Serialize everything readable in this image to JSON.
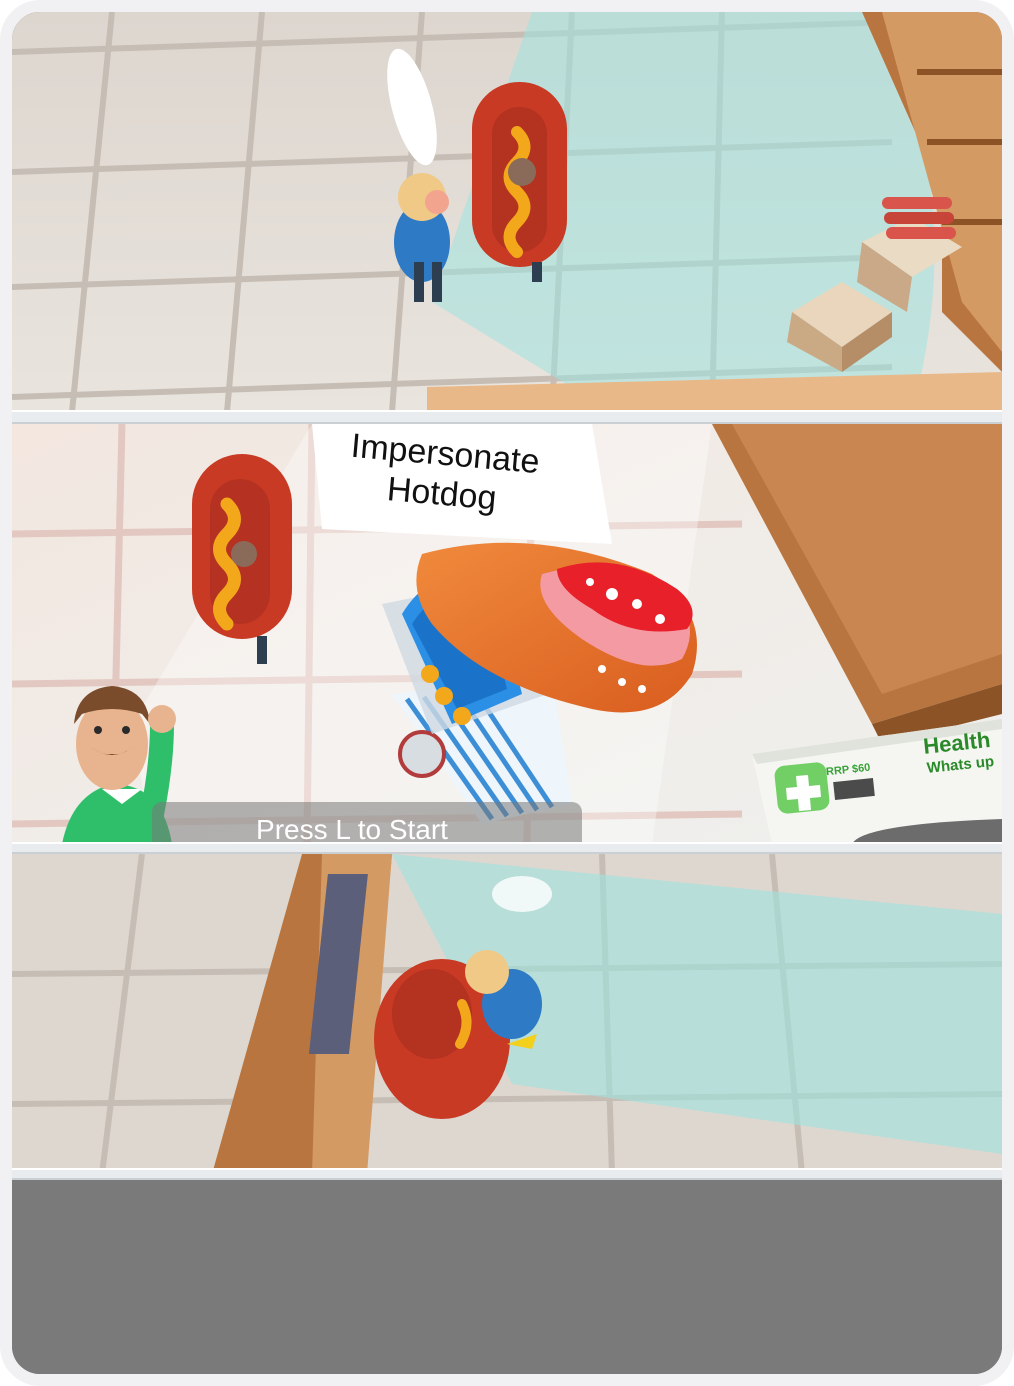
{
  "scene": {
    "panels": [
      "top-view",
      "cutscene",
      "bottom-view"
    ]
  },
  "speech_bubble": {
    "line1": "Impersonate",
    "line2": "Hotdog"
  },
  "prompt": {
    "text": "Press L to Start"
  },
  "product_box": {
    "brand": "Health",
    "tagline": "Whats up",
    "price": "RRP $60",
    "icon": "medical-cross-icon"
  },
  "colors": {
    "floor_light": "#e7e2dc",
    "floor_lines": "#c9c1b8",
    "vision_cone": "#9fe3e0",
    "hotdog_bun": "#c83a24",
    "mustard": "#f3a81c",
    "wood": "#b8753f",
    "device_bezel": "#f1f1f3",
    "bottom_bar": "#7a7a7a"
  }
}
